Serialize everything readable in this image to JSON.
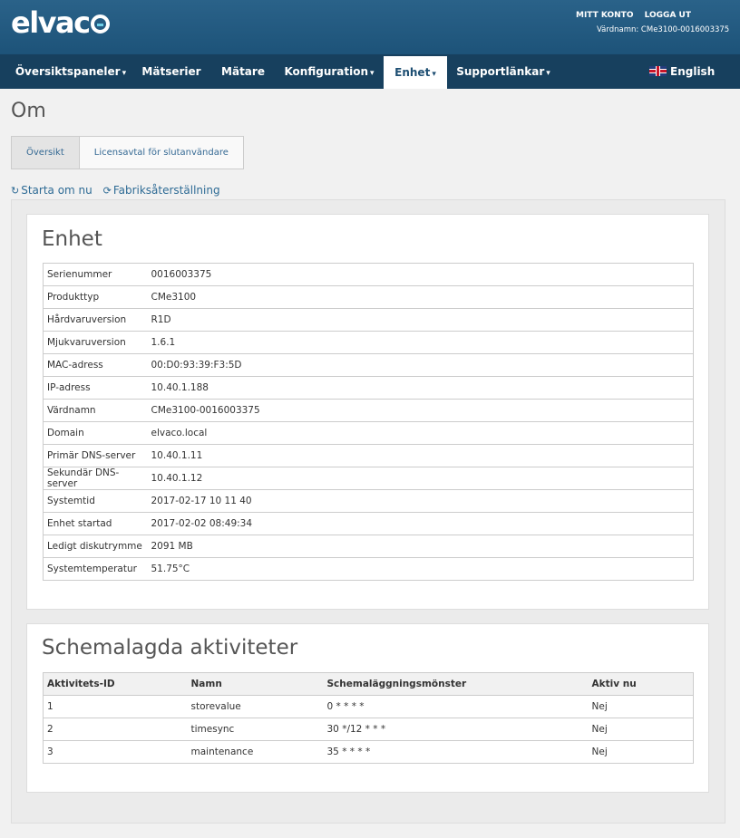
{
  "brand": {
    "logo_prefix": "elvac",
    "accent": "#6fd0e8",
    "header_bg": "#245b82",
    "nav_bg": "#17405e"
  },
  "top": {
    "account": "MITT KONTO",
    "logout": "LOGGA UT",
    "hostname_line": "Värdnamn: CMe3100-0016003375"
  },
  "nav": {
    "items": [
      {
        "label": "Översiktspaneler",
        "caret": "▾"
      },
      {
        "label": "Mätserier"
      },
      {
        "label": "Mätare"
      },
      {
        "label": "Konfiguration",
        "caret": "▾"
      },
      {
        "label": "Enhet",
        "caret": "▾",
        "active": true
      },
      {
        "label": "Supportlänkar",
        "caret": "▾"
      }
    ],
    "language": "English",
    "language_icon": "uk-flag-icon"
  },
  "page": {
    "title": "Om",
    "tabs": [
      "Översikt",
      "Licensavtal för slutanvändare"
    ],
    "actions": {
      "restart": "Starta om nu",
      "restart_icon": "↻",
      "factory_reset": "Fabriksåterställning",
      "factory_reset_icon": "⟳"
    }
  },
  "device": {
    "title": "Enhet",
    "rows": [
      {
        "label": "Serienummer",
        "value": "0016003375"
      },
      {
        "label": "Produkttyp",
        "value": "CMe3100"
      },
      {
        "label": "Hårdvaruversion",
        "value": "R1D"
      },
      {
        "label": "Mjukvaruversion",
        "value": "1.6.1"
      },
      {
        "label": "MAC-adress",
        "value": "00:D0:93:39:F3:5D"
      },
      {
        "label": "IP-adress",
        "value": "10.40.1.188"
      },
      {
        "label": "Värdnamn",
        "value": "CMe3100-0016003375"
      },
      {
        "label": "Domain",
        "value": "elvaco.local"
      },
      {
        "label": "Primär DNS-server",
        "value": "10.40.1.11"
      },
      {
        "label": "Sekundär DNS-server",
        "value": "10.40.1.12"
      },
      {
        "label": "Systemtid",
        "value": "2017-02-17 10 11 40"
      },
      {
        "label": "Enhet startad",
        "value": "2017-02-02 08:49:34"
      },
      {
        "label": "Ledigt diskutrymme",
        "value": "2091 MB"
      },
      {
        "label": "Systemtemperatur",
        "value": "51.75°C"
      }
    ]
  },
  "schedule": {
    "title": "Schemalagda aktiviteter",
    "columns": [
      "Aktivitets-ID",
      "Namn",
      "Schemaläggningsmönster",
      "Aktiv nu"
    ],
    "rows": [
      [
        "1",
        "storevalue",
        "0 * * * *",
        "Nej"
      ],
      [
        "2",
        "timesync",
        "30 */12 * * *",
        "Nej"
      ],
      [
        "3",
        "maintenance",
        "35 * * * *",
        "Nej"
      ]
    ]
  }
}
